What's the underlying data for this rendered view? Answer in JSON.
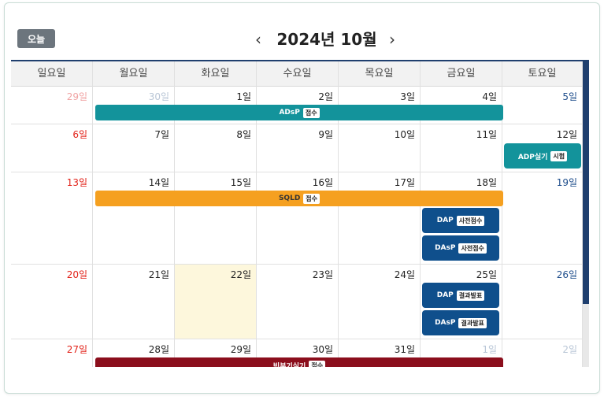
{
  "toolbar": {
    "today_label": "오늘",
    "prev_label": "‹",
    "next_label": "›",
    "month_title": "2024년 10월"
  },
  "weekdays": [
    "일요일",
    "월요일",
    "화요일",
    "수요일",
    "목요일",
    "금요일",
    "토요일"
  ],
  "weeks": [
    [
      "29일",
      "30일",
      "1일",
      "2일",
      "3일",
      "4일",
      "5일"
    ],
    [
      "6일",
      "7일",
      "8일",
      "9일",
      "10일",
      "11일",
      "12일"
    ],
    [
      "13일",
      "14일",
      "15일",
      "16일",
      "17일",
      "18일",
      "19일"
    ],
    [
      "20일",
      "21일",
      "22일",
      "23일",
      "24일",
      "25일",
      "26일"
    ],
    [
      "27일",
      "28일",
      "29일",
      "30일",
      "31일",
      "1일",
      "2일"
    ]
  ],
  "events": {
    "adsp_reg": {
      "title": "ADsP",
      "tag": "접수",
      "color": "#13939b"
    },
    "adp_exam": {
      "title": "ADP실기",
      "tag": "시험",
      "color": "#13939b"
    },
    "sqld_reg": {
      "title": "SQLD",
      "tag": "접수",
      "color": "#f5a020"
    },
    "dap_pre": {
      "title": "DAP",
      "tag": "사전점수",
      "color": "#0f4f8c"
    },
    "dasp_pre": {
      "title": "DAsP",
      "tag": "사전점수",
      "color": "#0f4f8c"
    },
    "dap_result": {
      "title": "DAP",
      "tag": "결과발표",
      "color": "#0f4f8c"
    },
    "dasp_result": {
      "title": "DAsP",
      "tag": "결과발표",
      "color": "#0f4f8c"
    },
    "bigdata_reg": {
      "title": "빅분기실기",
      "tag": "접수",
      "color": "#8b0e1c"
    }
  }
}
